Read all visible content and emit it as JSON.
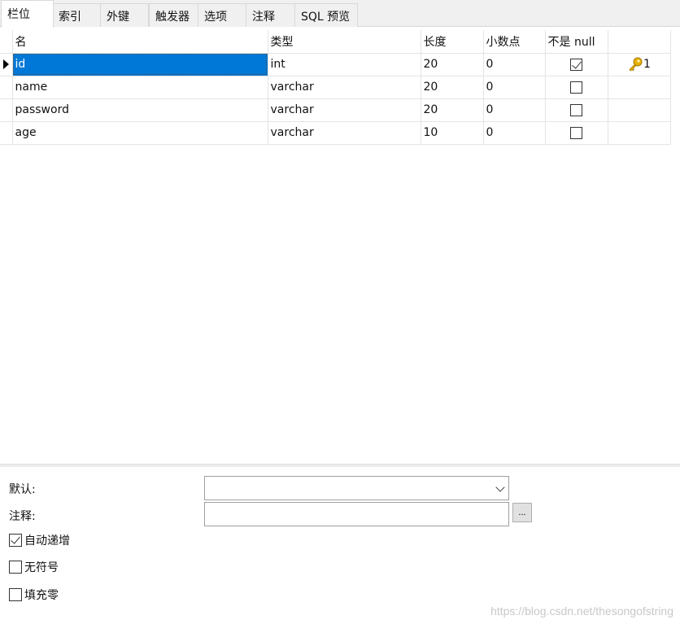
{
  "tabs": [
    {
      "label": "栏位",
      "active": true
    },
    {
      "label": "索引",
      "active": false
    },
    {
      "label": "外键",
      "active": false
    },
    {
      "label": "触发器",
      "active": false
    },
    {
      "label": "选项",
      "active": false
    },
    {
      "label": "注释",
      "active": false
    },
    {
      "label": "SQL 预览",
      "active": false
    }
  ],
  "grid": {
    "headers": {
      "name": "名",
      "type": "类型",
      "length": "长度",
      "decimals": "小数点",
      "not_null": "不是 null",
      "key": ""
    },
    "rows": [
      {
        "name": "id",
        "type": "int",
        "length": "20",
        "decimals": "0",
        "not_null": true,
        "key": "1",
        "selected": true
      },
      {
        "name": "name",
        "type": "varchar",
        "length": "20",
        "decimals": "0",
        "not_null": false,
        "key": ""
      },
      {
        "name": "password",
        "type": "varchar",
        "length": "20",
        "decimals": "0",
        "not_null": false,
        "key": ""
      },
      {
        "name": "age",
        "type": "varchar",
        "length": "10",
        "decimals": "0",
        "not_null": false,
        "key": ""
      }
    ]
  },
  "props": {
    "default_label": "默认:",
    "default_value": "",
    "comment_label": "注释:",
    "comment_value": "",
    "ellipsis_label": "...",
    "auto_increment_label": "自动递增",
    "auto_increment": true,
    "unsigned_label": "无符号",
    "unsigned": false,
    "zerofill_label": "填充零",
    "zerofill": false
  },
  "watermark": "https://blog.csdn.net/thesongofstring",
  "colors": {
    "selection": "#0078d7",
    "key_icon": "#e8b000"
  },
  "icons": {
    "row_pointer": "triangle-right-icon",
    "primary_key": "key-icon",
    "dropdown": "chevron-down-icon"
  }
}
